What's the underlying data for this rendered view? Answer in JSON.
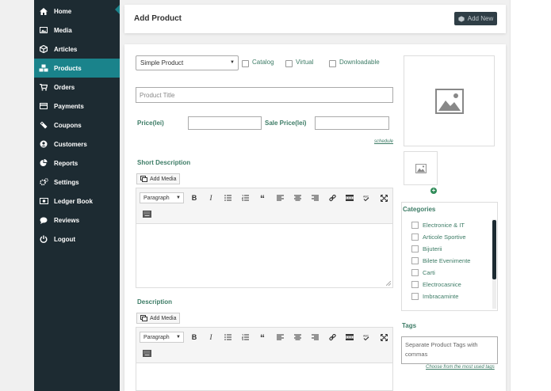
{
  "sidebar": {
    "items": [
      {
        "label": "Home",
        "icon": "home-icon"
      },
      {
        "label": "Media",
        "icon": "image-icon"
      },
      {
        "label": "Articles",
        "icon": "cube-icon"
      },
      {
        "label": "Products",
        "icon": "cubes-icon",
        "active": true
      },
      {
        "label": "Orders",
        "icon": "cart-icon"
      },
      {
        "label": "Payments",
        "icon": "credit-card-icon"
      },
      {
        "label": "Coupons",
        "icon": "ticket-icon"
      },
      {
        "label": "Customers",
        "icon": "user-circle-icon"
      },
      {
        "label": "Reports",
        "icon": "pie-chart-icon"
      },
      {
        "label": "Settings",
        "icon": "cogs-icon"
      },
      {
        "label": "Ledger Book",
        "icon": "money-icon"
      },
      {
        "label": "Reviews",
        "icon": "comment-icon"
      },
      {
        "label": "Logout",
        "icon": "power-icon"
      }
    ]
  },
  "header": {
    "title": "Add Product",
    "add_new": "Add New"
  },
  "form": {
    "product_type": "Simple Product",
    "catalog": "Catalog",
    "virtual": "Virtual",
    "downloadable": "Downloadable",
    "title_placeholder": "Product Title",
    "price_label": "Price(lei)",
    "sale_price_label": "Sale Price(lei)",
    "schedule": "schedule",
    "short_description": "Short Description",
    "description": "Description",
    "add_media": "Add Media",
    "paragraph": "Paragraph"
  },
  "categories": {
    "title": "Categories",
    "items": [
      "Electronice & IT",
      "Articole Sportive",
      "Bijuterii",
      "Bilete Evenimente",
      "Carti",
      "Electrocasnice",
      "Imbracaminte"
    ]
  },
  "tags": {
    "title": "Tags",
    "placeholder": "Separate Product Tags with commas",
    "choose": "Choose from the most used tags"
  },
  "colors": {
    "sidebar": "#1d2b32",
    "active": "#1a838b",
    "label_green": "#3d7c66"
  }
}
